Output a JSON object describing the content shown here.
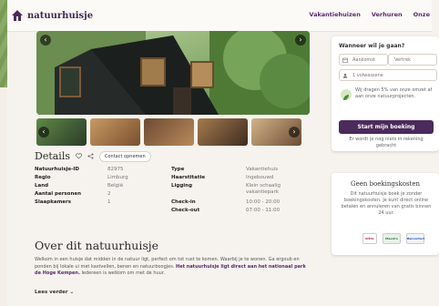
{
  "brand": {
    "name": "natuurhuisje",
    "color": "#4b2a5c"
  },
  "nav": {
    "items": [
      "Vakantiehuizen",
      "Verhuren",
      "Onze"
    ]
  },
  "details": {
    "title": "Details",
    "contact_label": "Contact opnemen",
    "left": [
      {
        "label": "Natuurhuisje-ID",
        "value": "82975"
      },
      {
        "label": "Regio",
        "value": "Limburg"
      },
      {
        "label": "Land",
        "value": "België"
      },
      {
        "label": "Aantal personen",
        "value": "2"
      },
      {
        "label": "Slaapkamers",
        "value": "1"
      }
    ],
    "right": [
      {
        "label": "Type",
        "value": "Vakantiehuis"
      },
      {
        "label": "Haarstitatie",
        "value": "Ingebouwd"
      },
      {
        "label": "Ligging",
        "value": "Klein schaalig vakantiepark"
      },
      {
        "label": "Check-in",
        "value": "10:00 - 20:00"
      },
      {
        "label": "Check-out",
        "value": "07:00 - 11:00"
      }
    ]
  },
  "about": {
    "title": "Over dit natuurhuisje",
    "paragraph_1": "Welkom in een huisje dat midden in de natuur ligt, perfect om tot rust te komen.",
    "paragraph_2": "Waarbij je te wonen. Ga ergoub en ponden bij lokale ui met kastvellen, benen en natuurboogjes.",
    "highlight": "Het natuurhuisje ligt direct aan het nationaal park de Hoge Kempen.",
    "paragraph_3": "Iedereen is welkom om met de huur.",
    "read_more": "Lees verder"
  },
  "booking": {
    "question": "Wanneer wil je gaan?",
    "arrival_placeholder": "Aankomst",
    "departure_placeholder": "Vertrek",
    "guests_placeholder": "1 volwassene",
    "eco_text": "Wij dragen 5% van onze omzet af aan onze natuurprojecten.",
    "start_button": "Start mijn boeking",
    "note": "Er wordt je nog niets in rekening gebracht"
  },
  "booking_costs": {
    "title": "Geen boekingskosten",
    "text": "Dit natuurhuisje boek je zonder boekingskosten. Je kunt direct online betalen en annuleren van gratis binnen 24 uur."
  },
  "payment_methods": [
    "iDEAL",
    "Maestro",
    "Bancontact"
  ]
}
